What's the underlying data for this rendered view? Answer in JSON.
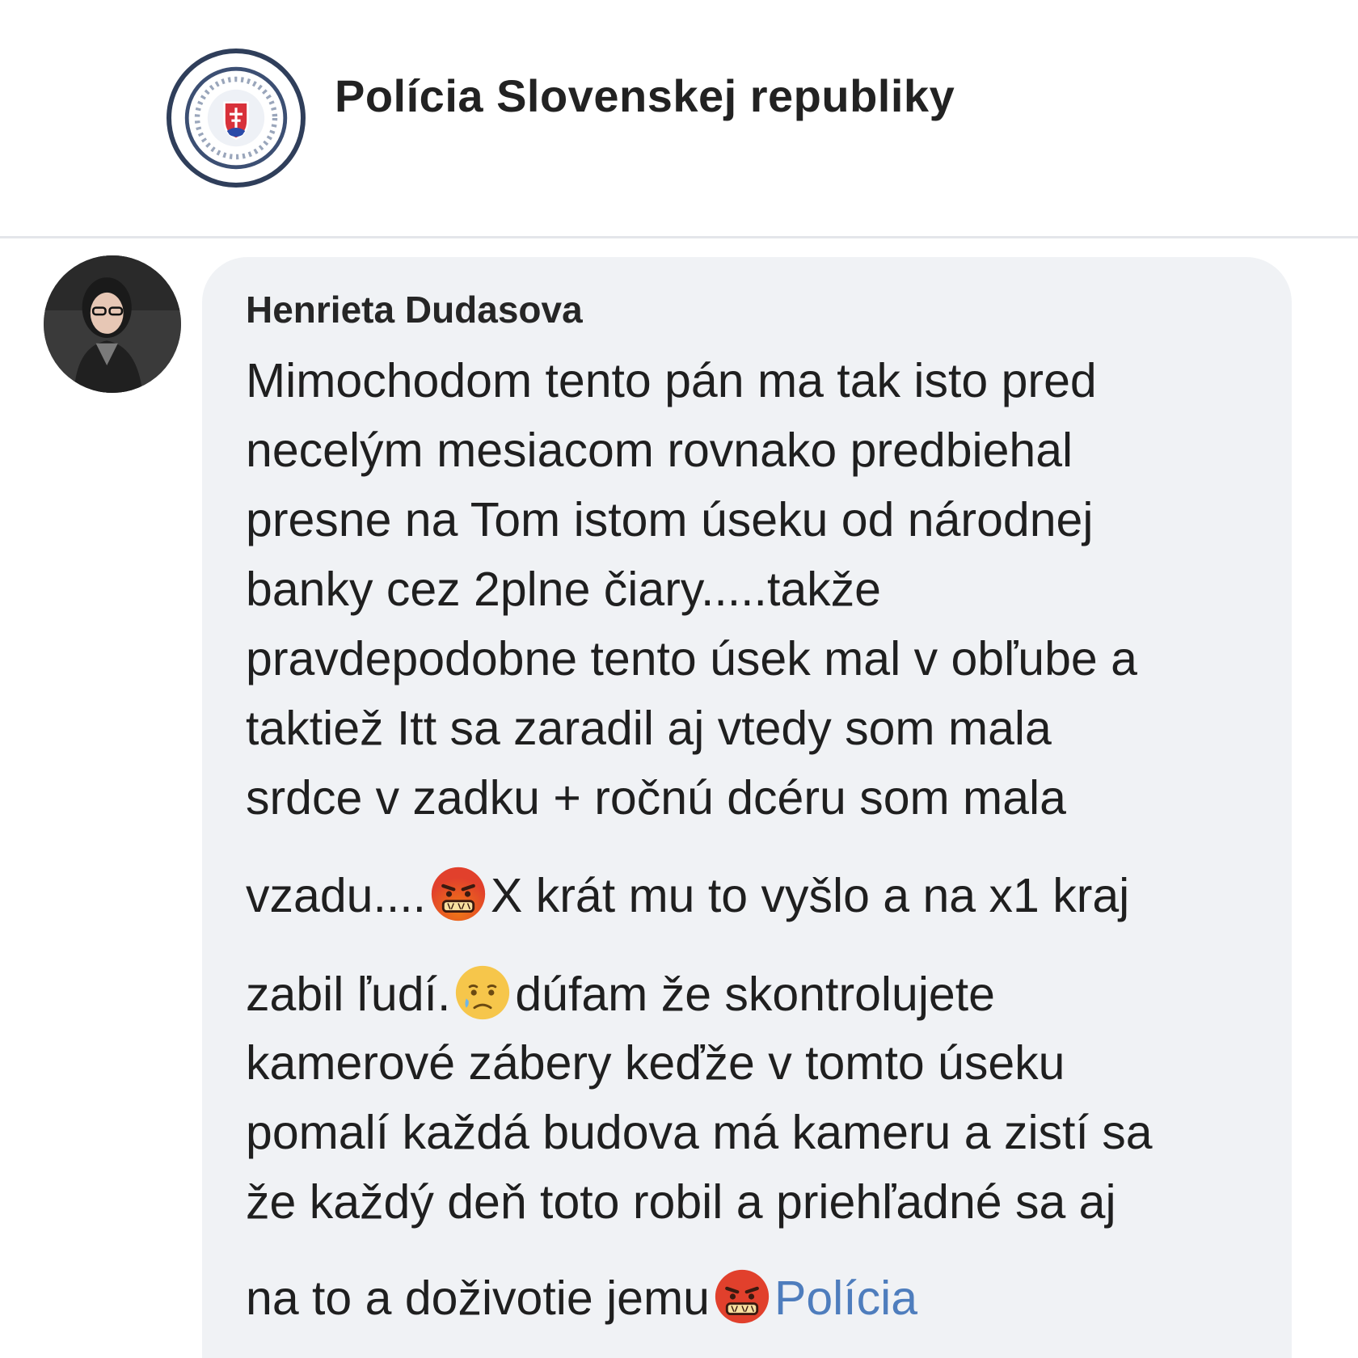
{
  "header": {
    "page_name": "Polícia Slovenskej republiky"
  },
  "comment": {
    "author": "Henrieta Dudasova",
    "lines": [
      "Mimochodom tento pán ma tak isto pred",
      "necelým mesiacom rovnako predbiehal",
      "presne na Tom istom úseku od národnej",
      "banky cez 2plne čiary.....takže",
      "pravdepodobne tento úsek mal v obľube a",
      "taktiež Itt sa zaradil aj vtedy som mala",
      "srdce v zadku + ročnú dcéru som mala"
    ],
    "line8_before": "vzadu....",
    "line8_after": "X krát mu to vyšlo a na x1 kraj",
    "line9_before": "zabil ľudí.",
    "line9_after": "dúfam že skontrolujete",
    "lines_b": [
      "kamerové zábery keďže v tomto úseku",
      "pomalí každá budova má kameru a zistí sa",
      "že každý deň toto robil a priehľadné sa aj"
    ],
    "last_line_before": "na to a doživotie jemu",
    "mention": "Polícia",
    "emojis": [
      "cursing-face-emoji",
      "sad-tear-face-emoji",
      "cursing-face-emoji"
    ]
  },
  "colors": {
    "bubble": "#f0f2f5",
    "mention": "#4e7dbd",
    "divider": "#e4e6ea"
  }
}
